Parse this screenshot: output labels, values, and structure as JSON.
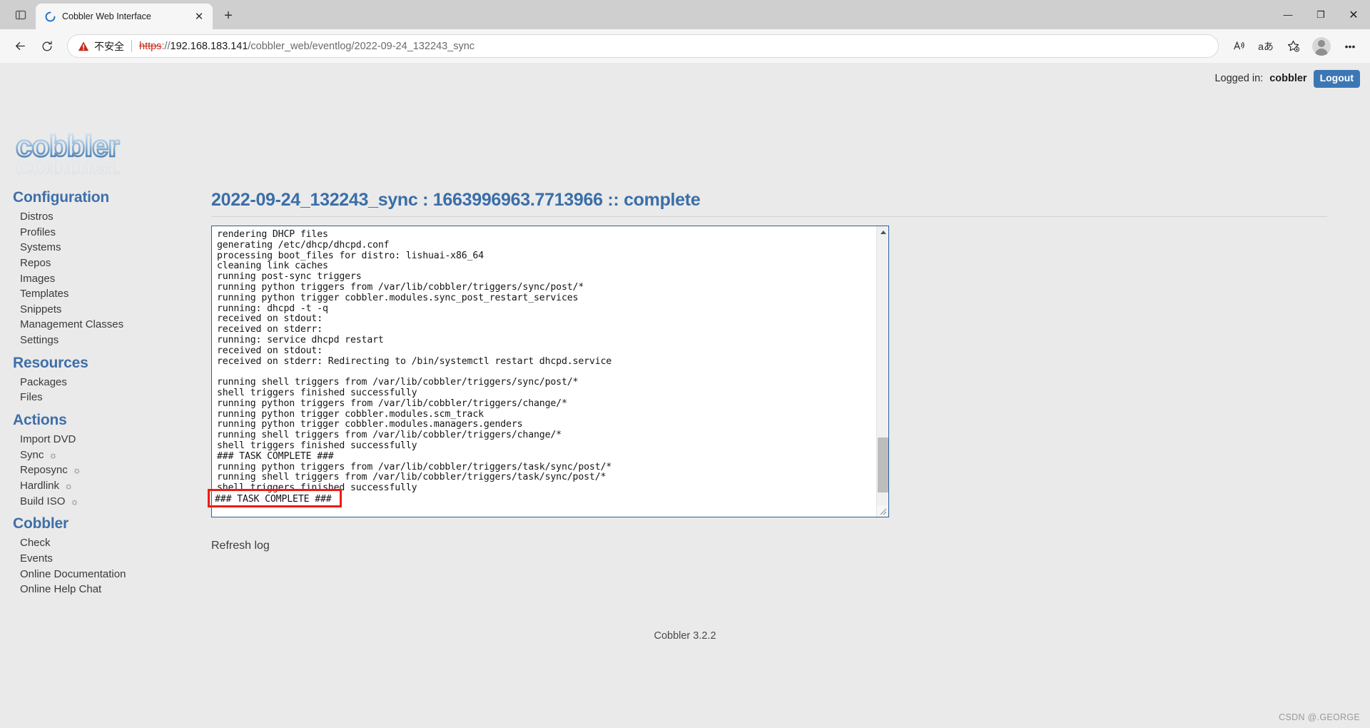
{
  "browser": {
    "tab": {
      "title": "Cobbler Web Interface",
      "favicon_name": "cobbler-loading-favicon",
      "close_label": "✕"
    },
    "new_tab_label": "+",
    "window_controls": {
      "minimize": "—",
      "maximize": "❐",
      "close": "✕"
    },
    "nav": {
      "back": "←",
      "reload": "↻"
    },
    "omnibox": {
      "security_warning": "不安全",
      "scheme": "https",
      "scheme_suffix": "://",
      "host": "192.168.183.141",
      "path": "/cobbler_web/eventlog/2022-09-24_132243_sync"
    },
    "toolbar_icons": [
      {
        "name": "read-aloud-icon",
        "glyph": "A"
      },
      {
        "name": "translate-icon",
        "glyph": "aあ"
      },
      {
        "name": "add-favorite-icon",
        "glyph": "☆"
      }
    ],
    "more_label": "•••"
  },
  "topbar": {
    "logged_in_label": "Logged in:",
    "username": "cobbler",
    "logout_label": "Logout"
  },
  "logo": {
    "text": "cobbler"
  },
  "sidebar": {
    "sections": [
      {
        "heading": "Configuration",
        "items": [
          {
            "label": "Distros",
            "sun": false
          },
          {
            "label": "Profiles",
            "sun": false
          },
          {
            "label": "Systems",
            "sun": false
          },
          {
            "label": "Repos",
            "sun": false
          },
          {
            "label": "Images",
            "sun": false
          },
          {
            "label": "Templates",
            "sun": false
          },
          {
            "label": "Snippets",
            "sun": false
          },
          {
            "label": "Management Classes",
            "sun": false
          },
          {
            "label": "Settings",
            "sun": false
          }
        ]
      },
      {
        "heading": "Resources",
        "items": [
          {
            "label": "Packages",
            "sun": false
          },
          {
            "label": "Files",
            "sun": false
          }
        ]
      },
      {
        "heading": "Actions",
        "items": [
          {
            "label": "Import DVD",
            "sun": false
          },
          {
            "label": "Sync",
            "sun": true
          },
          {
            "label": "Reposync",
            "sun": true
          },
          {
            "label": "Hardlink",
            "sun": true
          },
          {
            "label": "Build ISO",
            "sun": true
          }
        ]
      },
      {
        "heading": "Cobbler",
        "items": [
          {
            "label": "Check",
            "sun": false
          },
          {
            "label": "Events",
            "sun": false
          },
          {
            "label": "Online Documentation",
            "sun": false
          },
          {
            "label": "Online Help Chat",
            "sun": false
          }
        ]
      }
    ],
    "sun_glyph": "☼"
  },
  "main": {
    "page_title": "2022-09-24_132243_sync : 1663996963.7713966 :: complete",
    "log_lines": [
      "rendering DHCP files",
      "generating /etc/dhcp/dhcpd.conf",
      "processing boot_files for distro: lishuai-x86_64",
      "cleaning link caches",
      "running post-sync triggers",
      "running python triggers from /var/lib/cobbler/triggers/sync/post/*",
      "running python trigger cobbler.modules.sync_post_restart_services",
      "running: dhcpd -t -q",
      "received on stdout:",
      "received on stderr:",
      "running: service dhcpd restart",
      "received on stdout:",
      "received on stderr: Redirecting to /bin/systemctl restart dhcpd.service",
      "",
      "running shell triggers from /var/lib/cobbler/triggers/sync/post/*",
      "shell triggers finished successfully",
      "running python triggers from /var/lib/cobbler/triggers/change/*",
      "running python trigger cobbler.modules.scm_track",
      "running python trigger cobbler.modules.managers.genders",
      "running shell triggers from /var/lib/cobbler/triggers/change/*",
      "shell triggers finished successfully",
      "### TASK COMPLETE ###",
      "running python triggers from /var/lib/cobbler/triggers/task/sync/post/*",
      "running shell triggers from /var/lib/cobbler/triggers/task/sync/post/*",
      "shell triggers finished successfully"
    ],
    "annotation": {
      "highlight_text": "### TASK COMPLETE ###",
      "color": "#ef1b13"
    },
    "refresh_log_label": "Refresh log"
  },
  "footer": {
    "version": "Cobbler 3.2.2"
  },
  "watermark": "CSDN @.GEORGE",
  "colors": {
    "accent_blue": "#3a6ea8",
    "logout_blue": "#3c77b5",
    "page_bg": "#eaeaea",
    "log_border": "#2b5f9e",
    "annotation_red": "#ef1b13"
  }
}
